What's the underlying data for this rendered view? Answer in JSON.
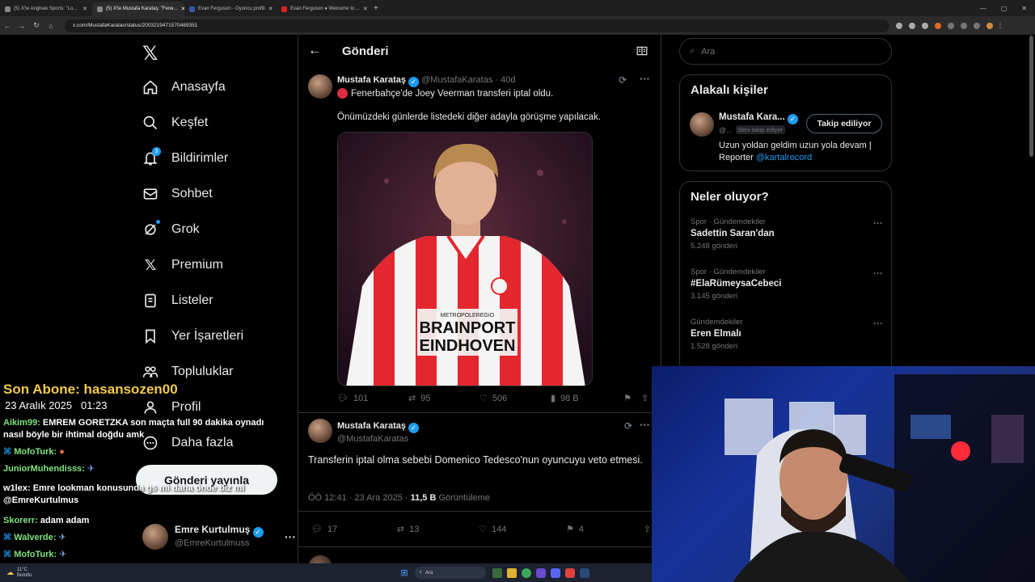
{
  "browser": {
    "tabs": [
      {
        "title": "(5) X'te Anghaw Sports: \"Lo...",
        "active": false
      },
      {
        "title": "(5) X'te Mustafa Karataş: \"Fene...",
        "active": true
      },
      {
        "title": "Evan Ferguson - Oyuncu profili",
        "active": false
      },
      {
        "title": "Evan Ferguson ● Welcome to ...",
        "active": false
      }
    ],
    "url": "x.com/MustafaKaratas/status/2003219471570469351"
  },
  "nav": {
    "items": [
      {
        "label": "Anasayfa",
        "icon": "home-icon"
      },
      {
        "label": "Keşfet",
        "icon": "search-icon"
      },
      {
        "label": "Bildirimler",
        "icon": "bell-icon",
        "badge": "3"
      },
      {
        "label": "Sohbet",
        "icon": "mail-icon"
      },
      {
        "label": "Grok",
        "icon": "grok-icon"
      },
      {
        "label": "Premium",
        "icon": "x-icon"
      },
      {
        "label": "Listeler",
        "icon": "list-icon"
      },
      {
        "label": "Yer İşaretleri",
        "icon": "bookmark-icon"
      },
      {
        "label": "Topluluklar",
        "icon": "people-icon"
      },
      {
        "label": "Profil",
        "icon": "person-icon"
      },
      {
        "label": "Daha fazla",
        "icon": "more-icon"
      }
    ],
    "compose_label": "Gönderi yayınla",
    "account": {
      "name": "Emre Kurtulmuş",
      "handle": "@EmreKurtulmuss"
    }
  },
  "main": {
    "header": "Gönderi",
    "tweet1": {
      "name": "Mustafa Karataş",
      "handle": "@MustafaKaratas",
      "time": "40d",
      "line1": "Fenerbahçe'de Joey Veerman transferi iptal oldu.",
      "line2": "Önümüzdeki günlerde listedeki diğer adayla görüşme yapılacak.",
      "image_text1": "BRAINPORT",
      "image_text2": "EINDHOVEN",
      "image_small": "METROPOLEREGIO",
      "replies": "101",
      "retweets": "95",
      "likes": "506",
      "views": "98 B"
    },
    "tweet2": {
      "name": "Mustafa Karataş",
      "handle": "@MustafaKaratas",
      "text": "Transferin iptal olma sebebi Domenico Tedesco'nun oyuncuyu veto etmesi.",
      "meta_time": "ÖÖ 12:41 · 23 Ara 2025 · ",
      "views_count": "11,5 B",
      "views_label": " Görüntüleme",
      "replies": "17",
      "retweets": "13",
      "likes": "144",
      "bookmarks": "4"
    }
  },
  "right": {
    "search_placeholder": "Ara",
    "related": {
      "title": "Alakalı kişiler",
      "name": "Mustafa Kara...",
      "handle": "@...",
      "follows_you": "Seni takip ediyor",
      "follow_btn": "Takip ediliyor",
      "bio": "Uzun yoldan geldim uzun yola devam | Reporter ",
      "bio_link": "@kartalrecord"
    },
    "trends": {
      "title": "Neler oluyor?",
      "items": [
        {
          "context": "Spor · Gündemdekiler",
          "name": "Sadettin Saran'dan",
          "count": "5.248 gönderi"
        },
        {
          "context": "Spor · Gündemdekiler",
          "name": "#ElaRümeysaCebeci",
          "count": "3.145 gönderi"
        },
        {
          "context": "Gündemdekiler",
          "name": "Eren Elmalı",
          "count": "1.528 gönderi"
        }
      ]
    }
  },
  "overlay": {
    "sub_label": "Son Abone: hasansozen00",
    "date": "23 Aralık 2025",
    "time": "01:23",
    "chat": [
      {
        "user": "Aikim99:",
        "text": "EMREM GORETZKA son maçta full 90 dakika oynadı nasıl böyle bir ihtimal doğdu amk",
        "color": "#7ee37e"
      },
      {
        "user": "MofoTurk:",
        "text": "",
        "color": "#7ee37e"
      },
      {
        "user": "JuniorMuhendisss:",
        "text": "",
        "color": "#7ee37e"
      },
      {
        "user": "w1lex:",
        "text": "Emre lookman konusunda gs mi daha önde biz mi @EmreKurtulmus",
        "color": "#ffffff"
      },
      {
        "user": "Skorerr:",
        "text": "adam adam",
        "color": "#7ee37e"
      },
      {
        "user": "Walverde:",
        "text": "",
        "color": "#7ee37e"
      },
      {
        "user": "MofoTurk:",
        "text": "",
        "color": "#7ee37e"
      }
    ]
  },
  "taskbar": {
    "weather_temp": "11°C",
    "weather_desc": "Bulutlu",
    "search_placeholder": "Ara"
  }
}
